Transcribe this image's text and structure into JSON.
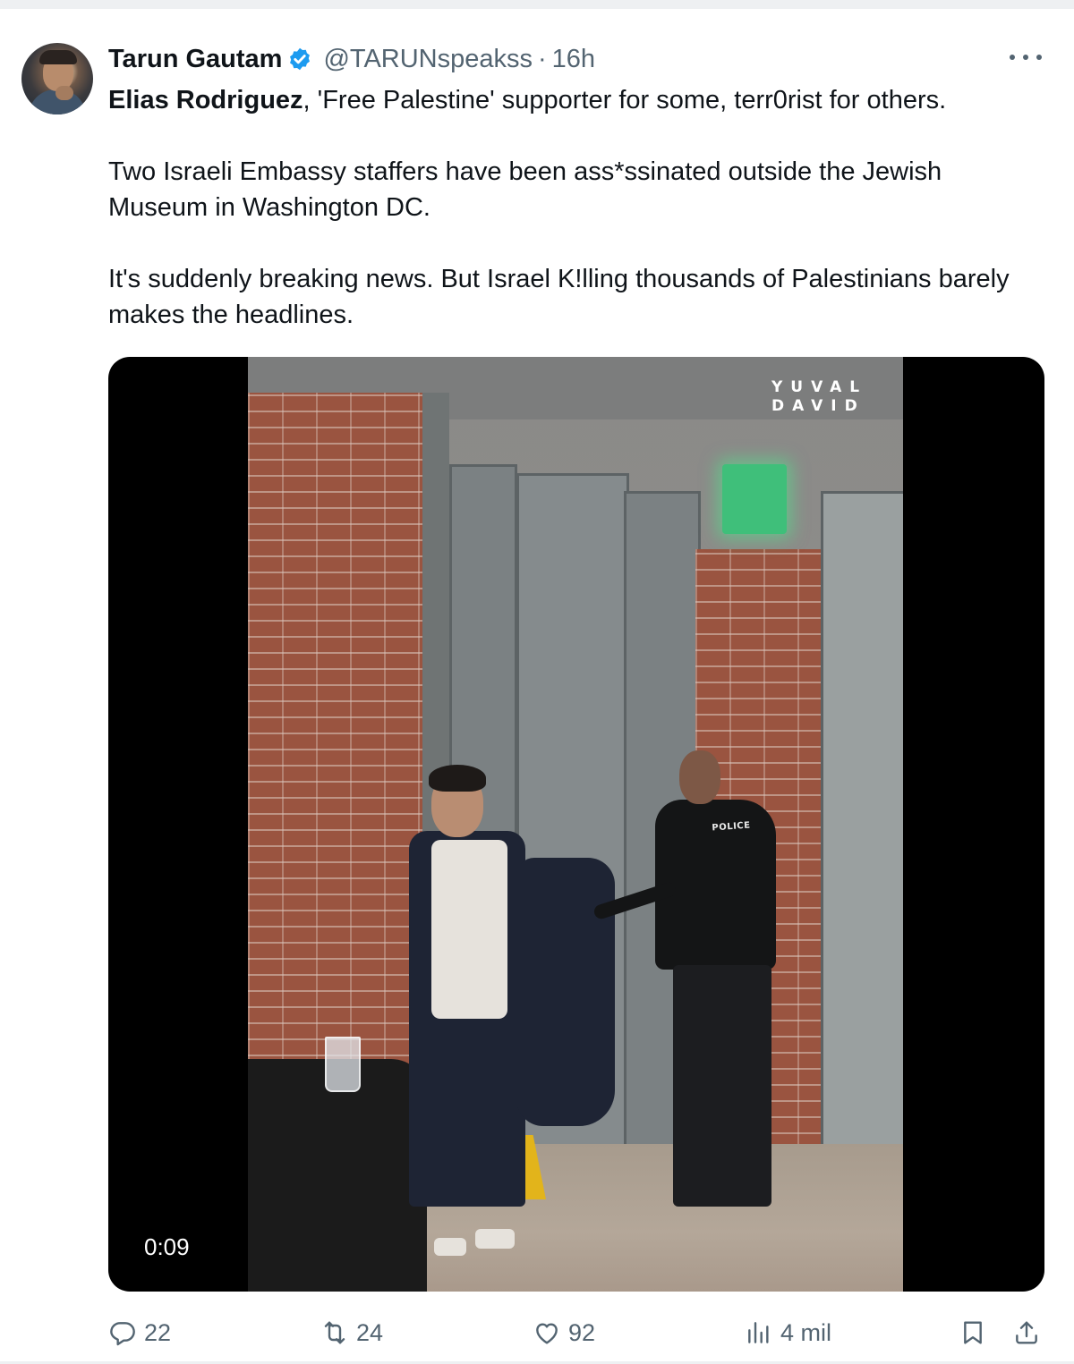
{
  "tweet": {
    "author_name": "Tarun Gautam",
    "handle": "@TARUNspeakss",
    "separator": "·",
    "time": "16h",
    "text": {
      "line1_bold": "Elias Rodriguez",
      "line1_rest": ", 'Free Palestine' supporter for some, terr0rist for others.",
      "paragraph2": "Two Israeli Embassy staffers have been ass*ssinated outside the Jewish Museum in Washington DC.",
      "paragraph3": "It's suddenly breaking news. But Israel K!lling thousands of Palestinians barely makes the headlines."
    },
    "video": {
      "watermark": "YUVAL\nDAVID",
      "officer_shirt_text": "POLICE",
      "duration": "0:09"
    },
    "actions": {
      "replies": "22",
      "reposts": "24",
      "likes": "92",
      "views": "4 mil"
    }
  },
  "icons": {
    "verified": "verified-badge-icon",
    "more": "more-horizontal-icon",
    "reply": "reply-icon",
    "repost": "repost-icon",
    "like": "heart-icon",
    "views": "views-chart-icon",
    "bookmark": "bookmark-icon",
    "share": "share-icon"
  },
  "colors": {
    "verified_blue": "#1d9bf0",
    "secondary_text": "#536471",
    "primary_text": "#0f1419"
  }
}
